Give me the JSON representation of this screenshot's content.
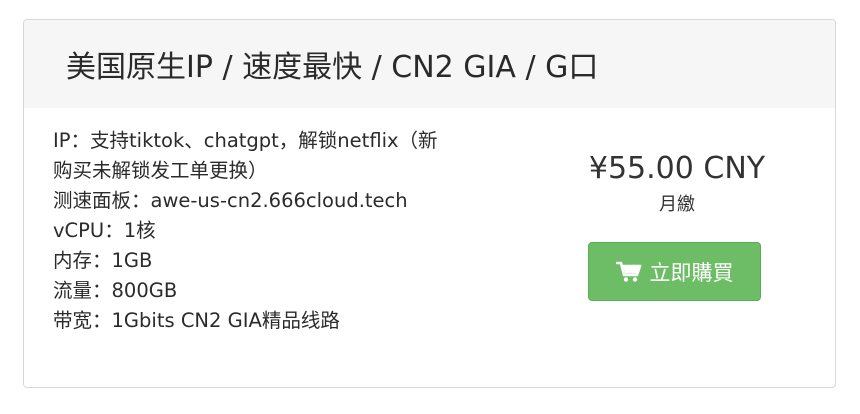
{
  "product": {
    "title": "美国原生IP / 速度最快 / CN2 GIA / G口",
    "features": [
      "IP：支持tiktok、chatgpt，解锁netflix（新",
      "购买未解锁发工单更换）",
      "测速面板：awe-us-cn2.666cloud.tech",
      "vCPU：1核",
      "内存：1GB",
      "流量：800GB",
      "带宽：1Gbits CN2 GIA精品线路"
    ],
    "price": "¥55.00 CNY",
    "billing_cycle": "月繳",
    "buy_label": "立即購買",
    "buy_icon": "shopping-cart-icon"
  },
  "colors": {
    "header_bg": "#f6f6f6",
    "button_bg": "#6cbd66",
    "border": "#d8d8d8"
  }
}
